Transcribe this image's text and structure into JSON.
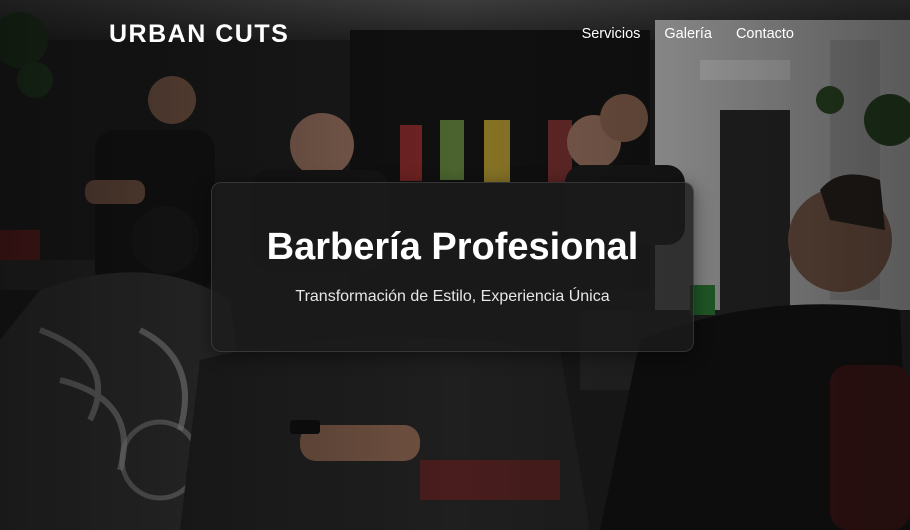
{
  "brand": {
    "name": "URBAN CUTS"
  },
  "nav": {
    "items": [
      {
        "label": "Servicios"
      },
      {
        "label": "Galería"
      },
      {
        "label": "Contacto"
      }
    ]
  },
  "hero": {
    "title": "Barbería Profesional",
    "subtitle": "Transformación de Estilo, Experiencia Única",
    "background_photo": "barbershop-interior-photo"
  },
  "colors": {
    "text_primary": "#ffffff",
    "card_background": "#1c1c1c",
    "page_dark": "#161616"
  }
}
